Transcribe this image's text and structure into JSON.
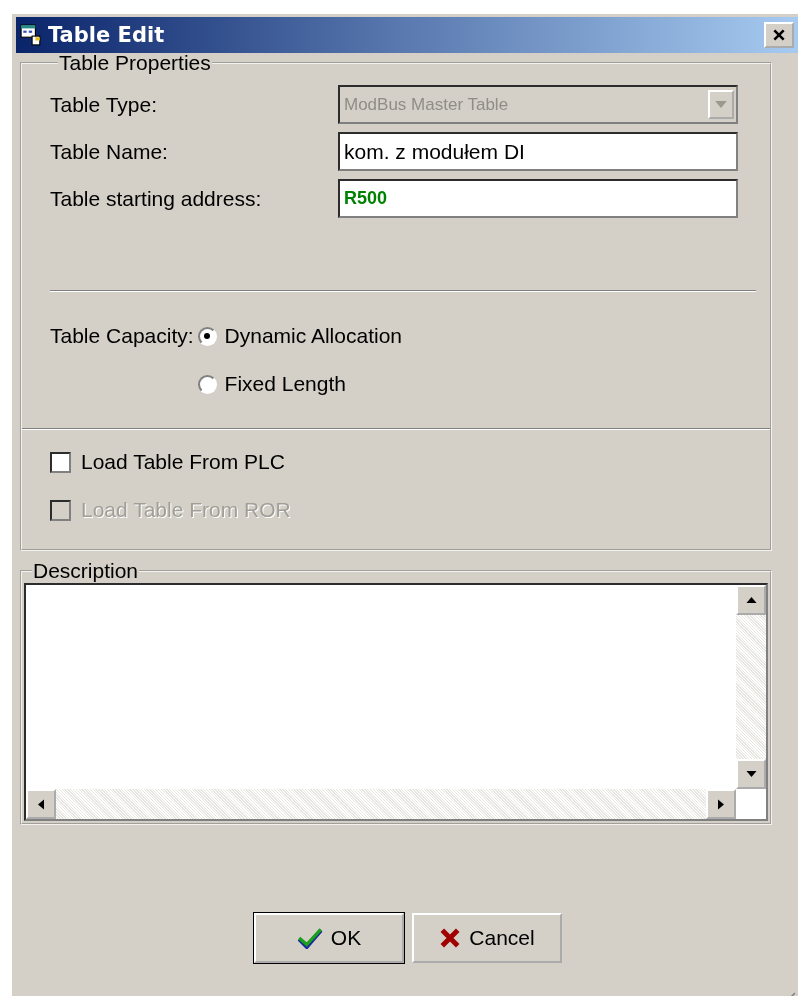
{
  "window": {
    "title": "Table Edit"
  },
  "properties": {
    "legend": "Table Properties",
    "fields": [
      {
        "kind": "dropdown",
        "label": "Table Type:",
        "value": "ModBus Master Table",
        "disabled": true
      },
      {
        "kind": "text",
        "label": "Table Name:",
        "value": "kom. z modułem DI",
        "disabled": false
      },
      {
        "kind": "address",
        "label": "Table starting address:",
        "value": "R500",
        "disabled": false
      }
    ],
    "capacity": {
      "label": "Table Capacity:",
      "options": [
        {
          "label": "Dynamic Allocation",
          "selected": true
        },
        {
          "label": "Fixed Length",
          "selected": false
        }
      ]
    },
    "checkboxes": [
      {
        "label": "Load Table From PLC",
        "checked": false,
        "disabled": false
      },
      {
        "label": "Load Table From ROR",
        "checked": false,
        "disabled": true
      }
    ]
  },
  "description": {
    "legend": "Description"
  },
  "buttons": [
    {
      "kind": "ok",
      "label": "OK"
    },
    {
      "kind": "cancel",
      "label": "Cancel"
    }
  ]
}
